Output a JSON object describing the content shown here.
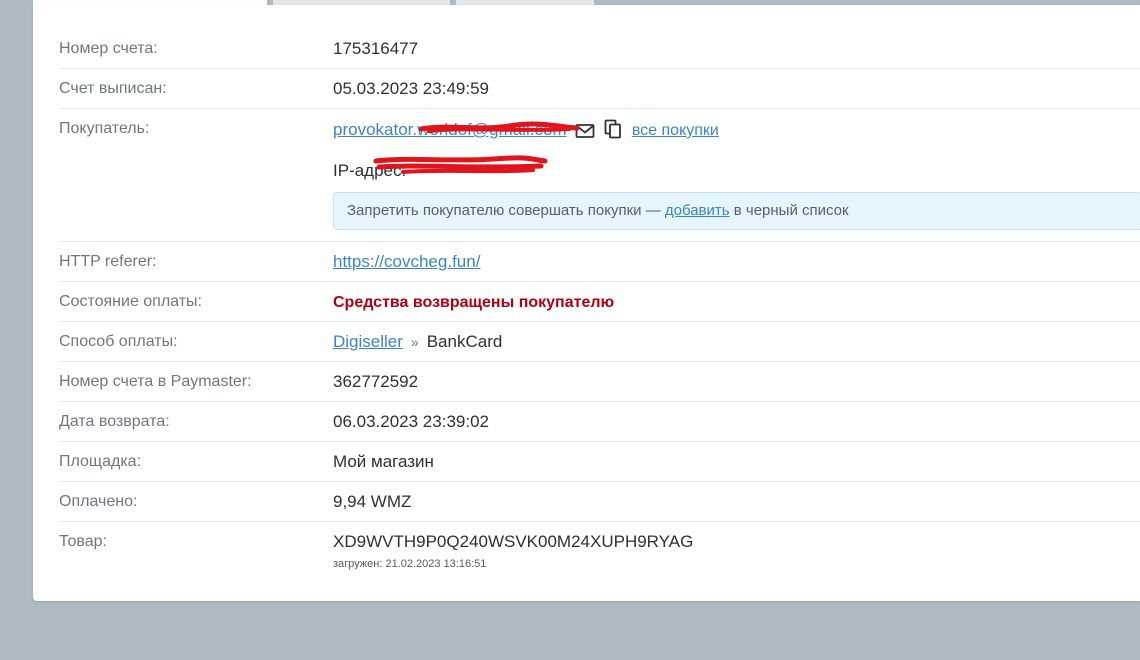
{
  "labels": {
    "account_number": "Номер счета:",
    "issued": "Счет выписан:",
    "buyer": "Покупатель:",
    "referer": "HTTP referer:",
    "payment_state": "Состояние оплаты:",
    "payment_method": "Способ оплаты:",
    "paymaster_number": "Номер счета в Paymaster:",
    "refund_date": "Дата возврата:",
    "platform": "Площадка:",
    "paid": "Оплачено:",
    "product": "Товар:"
  },
  "values": {
    "account_number": "175316477",
    "issued": "05.03.2023 23:49:59",
    "buyer_email": "provokator.worldof@gmail.com",
    "all_purchases": "все покупки",
    "ip_label": "IP-адрес:",
    "notice_prefix": "Запретить покупателю совершать покупки — ",
    "notice_link": "добавить",
    "notice_suffix": " в черный список",
    "referer": "https://covcheg.fun/",
    "payment_state": "Средства возвращены покупателю",
    "payment_method_link": "Digiseller",
    "payment_method_sep": "»",
    "payment_method": "BankCard",
    "paymaster_number": "362772592",
    "refund_date": "06.03.2023 23:39:02",
    "platform": "Мой магазин",
    "paid": "9,94 WMZ",
    "product": "XD9WVTH9P0Q240WSVK00M24XUPH9RYAG",
    "product_loaded": "загружен: 21.02.2023 13:16:51"
  },
  "icons": {
    "mail": "envelope-icon",
    "copy": "copy-icon"
  },
  "colors": {
    "link": "#3d85c6",
    "status_refunded": "#b00012",
    "redaction": "#e0141c",
    "notice_bg": "#e6f4fb"
  }
}
